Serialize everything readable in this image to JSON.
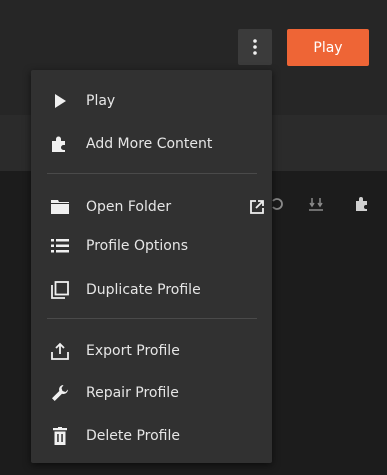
{
  "header": {
    "play_label": "Play"
  },
  "menu": {
    "items": [
      {
        "label": "Play",
        "icon": "play-icon"
      },
      {
        "label": "Add More Content",
        "icon": "puzzle-icon"
      },
      {
        "label": "Open Folder",
        "icon": "folder-icon"
      },
      {
        "label": "Profile Options",
        "icon": "list-icon"
      },
      {
        "label": "Duplicate Profile",
        "icon": "duplicate-icon"
      },
      {
        "label": "Export Profile",
        "icon": "export-icon"
      },
      {
        "label": "Repair Profile",
        "icon": "wrench-icon"
      },
      {
        "label": "Delete Profile",
        "icon": "trash-icon"
      }
    ]
  },
  "colors": {
    "accent": "#ee6536",
    "menu_bg": "#313131"
  }
}
